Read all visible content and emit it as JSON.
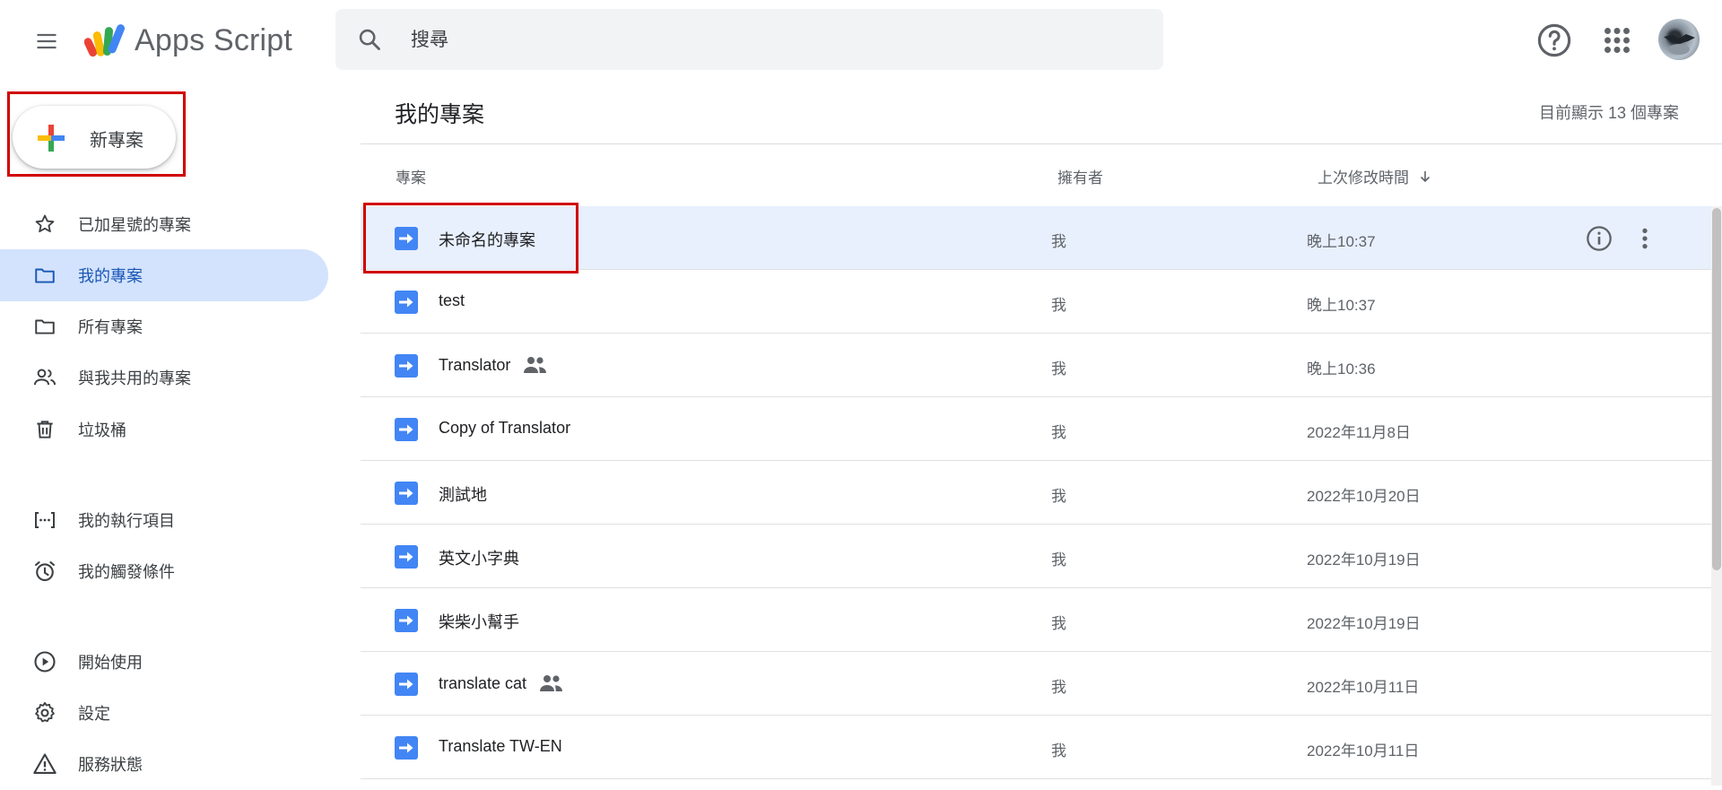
{
  "header": {
    "app_title": "Apps Script",
    "search_placeholder": "搜尋"
  },
  "sidebar": {
    "new_project_label": "新專案",
    "nav_group_1": [
      {
        "label": "已加星號的專案",
        "icon": "star-icon"
      },
      {
        "label": "我的專案",
        "icon": "folder-icon",
        "active": true
      },
      {
        "label": "所有專案",
        "icon": "folder-icon"
      },
      {
        "label": "與我共用的專案",
        "icon": "people-icon"
      },
      {
        "label": "垃圾桶",
        "icon": "trash-icon"
      }
    ],
    "nav_group_2": [
      {
        "label": "我的執行項目",
        "icon": "executions-icon"
      },
      {
        "label": "我的觸發條件",
        "icon": "alarm-icon"
      }
    ],
    "nav_group_3": [
      {
        "label": "開始使用",
        "icon": "play-circle-icon"
      },
      {
        "label": "設定",
        "icon": "gear-icon"
      },
      {
        "label": "服務狀態",
        "icon": "warning-icon"
      }
    ]
  },
  "main": {
    "title": "我的專案",
    "count_text": "目前顯示 13 個專案",
    "columns": {
      "project": "專案",
      "owner": "擁有者",
      "modified": "上次修改時間"
    },
    "rows": [
      {
        "name": "未命名的專案",
        "owner": "我",
        "modified": "晚上10:37",
        "shared": false,
        "selected": true
      },
      {
        "name": "test",
        "owner": "我",
        "modified": "晚上10:37",
        "shared": false
      },
      {
        "name": "Translator",
        "owner": "我",
        "modified": "晚上10:36",
        "shared": true
      },
      {
        "name": "Copy of Translator",
        "owner": "我",
        "modified": "2022年11月8日",
        "shared": false
      },
      {
        "name": "測試地",
        "owner": "我",
        "modified": "2022年10月20日",
        "shared": false
      },
      {
        "name": "英文小字典",
        "owner": "我",
        "modified": "2022年10月19日",
        "shared": false
      },
      {
        "name": "柴柴小幫手",
        "owner": "我",
        "modified": "2022年10月19日",
        "shared": false
      },
      {
        "name": "translate cat",
        "owner": "我",
        "modified": "2022年10月11日",
        "shared": true
      },
      {
        "name": "Translate TW-EN",
        "owner": "我",
        "modified": "2022年10月11日",
        "shared": false
      }
    ]
  },
  "colors": {
    "accent": "#1a73e8",
    "active_nav_bg": "#d3e3fd",
    "selected_row_bg": "#e8f0fe",
    "highlight_border": "#d00000",
    "file_icon": "#4285f4"
  }
}
